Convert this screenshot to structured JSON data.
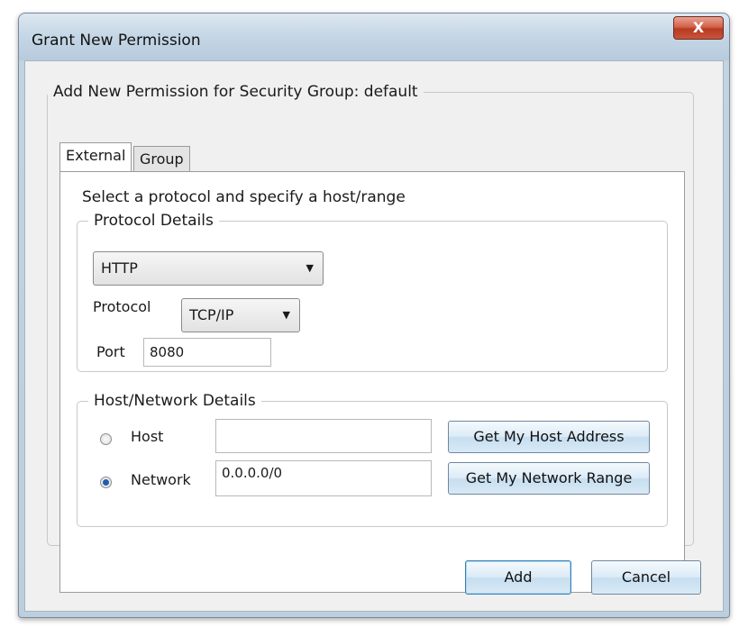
{
  "window": {
    "title": "Grant New Permission",
    "close_glyph": "X"
  },
  "outer_group": {
    "legend": "Add New Permission for Security Group: default"
  },
  "tabs": [
    {
      "label": "External",
      "active": true
    },
    {
      "label": "Group",
      "active": false
    }
  ],
  "external": {
    "instruction": "Select a protocol and specify a host/range",
    "protocol_details": {
      "legend": "Protocol Details",
      "service_select": {
        "value": "HTTP"
      },
      "protocol_label": "Protocol",
      "protocol_select": {
        "value": "TCP/IP"
      },
      "port_label": "Port",
      "port_value": "8080"
    },
    "host_network": {
      "legend": "Host/Network Details",
      "host_label": "Host",
      "host_value": "",
      "host_selected": false,
      "network_label": "Network",
      "network_value": "0.0.0.0/0",
      "network_selected": true,
      "get_host_button": "Get My Host Address",
      "get_network_button": "Get My Network Range"
    }
  },
  "footer": {
    "add_button": "Add",
    "cancel_button": "Cancel"
  },
  "icons": {
    "dropdown_arrow": "triangle-down",
    "close": "close-x"
  }
}
